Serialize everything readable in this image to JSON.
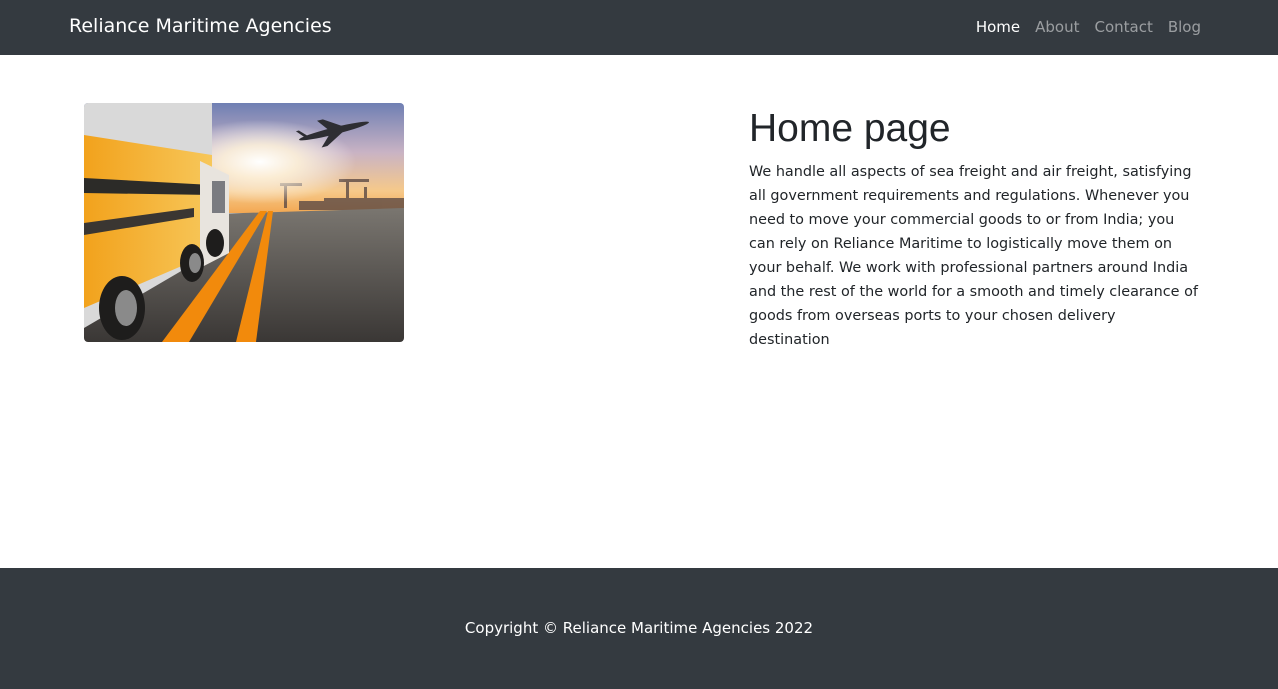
{
  "navbar": {
    "brand": "Reliance Maritime Agencies",
    "links": [
      {
        "label": "Home",
        "active": true
      },
      {
        "label": "About",
        "active": false
      },
      {
        "label": "Contact",
        "active": false
      },
      {
        "label": "Blog",
        "active": false
      }
    ]
  },
  "main": {
    "title": "Home page",
    "body": "We handle all aspects of sea freight and air freight, satisfying all government requirements and regulations. Whenever you need to move your commercial goods to or from India; you can rely on Reliance Maritime to logistically move them on your behalf. We work with professional partners around India and the rest of the world for a smooth and timely clearance of goods from overseas ports to your chosen delivery destination"
  },
  "footer": {
    "copyright": "Copyright © Reliance Maritime Agencies 2022"
  },
  "colors": {
    "navbar_bg": "#343a40",
    "footer_bg": "#343a40",
    "text": "#212529"
  }
}
